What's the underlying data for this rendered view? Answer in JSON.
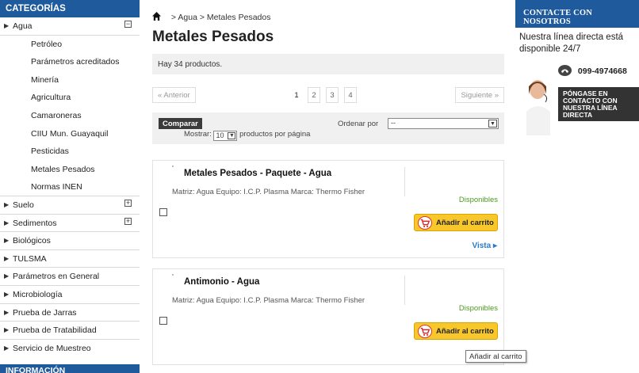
{
  "sidebar": {
    "heading": "CATEGORÍAS",
    "agua": {
      "label": "Agua",
      "toggle": "−"
    },
    "agua_children": [
      "Petróleo",
      "Parámetros acreditados",
      "Minería",
      "Agricultura",
      "Camaroneras",
      "CIIU Mun. Guayaquil",
      "Pesticidas",
      "Metales Pesados",
      "Normas INEN"
    ],
    "items": [
      {
        "label": "Suelo",
        "toggle": "+"
      },
      {
        "label": "Sedimentos",
        "toggle": "+"
      },
      {
        "label": "Biológicos"
      },
      {
        "label": "TULSMA"
      },
      {
        "label": "Parámetros en General"
      },
      {
        "label": "Microbiología"
      },
      {
        "label": "Prueba de Jarras"
      },
      {
        "label": "Prueba de Tratabilidad"
      },
      {
        "label": "Servicio de Muestreo"
      }
    ],
    "info_heading": "INFORMACIÓN"
  },
  "breadcrumb": {
    "sep1": ">",
    "parent": "Agua",
    "sep2": ">",
    "current": "Metales Pesados"
  },
  "page_title": "Metales Pesados",
  "product_count": "Hay 34 productos.",
  "pagination": {
    "prev": "« Anterior",
    "pages": [
      "1",
      "2",
      "3",
      "4"
    ],
    "current_page": "1",
    "next": "Siguiente »"
  },
  "sort_bar": {
    "compare_label": "Comparar",
    "order_label": "Ordenar por",
    "order_value": "--",
    "show_label": "Mostrar:",
    "show_value": "10",
    "per_page_label": "productos por página"
  },
  "products": [
    {
      "name": "Metales Pesados - Paquete - Agua",
      "desc": "Matriz: Agua Equipo: I.C.P. Plasma  Marca: Thermo Fisher",
      "availability": "Disponibles",
      "cart_label": "Añadir al carrito",
      "view_label": "Vista ▸"
    },
    {
      "name": "Antimonio - Agua",
      "desc": "Matriz: Agua Equipo: I.C.P. Plasma Marca: Thermo Fisher",
      "availability": "Disponibles",
      "cart_label": "Añadir al carrito"
    }
  ],
  "tooltip": "Añadir al carrito",
  "contact": {
    "heading": "CONTACTE CON NOSOTROS",
    "text": "Nuestra línea directa está disponible 24/7",
    "phone": "099-4974668",
    "cta": "PÓNGASE EN CONTACTO CON NUESTRA LÍNEA DIRECTA"
  },
  "colors": {
    "brand_blue": "#1e5a9c",
    "available_green": "#4c9a1f",
    "cart_yellow": "#f7c72c",
    "link_blue": "#2a7bc8"
  },
  "icons": [
    "home-icon",
    "cart-icon",
    "phone-icon",
    "arrow-right-icon",
    "collapse-icon",
    "expand-icon",
    "dropdown-arrow-icon"
  ]
}
